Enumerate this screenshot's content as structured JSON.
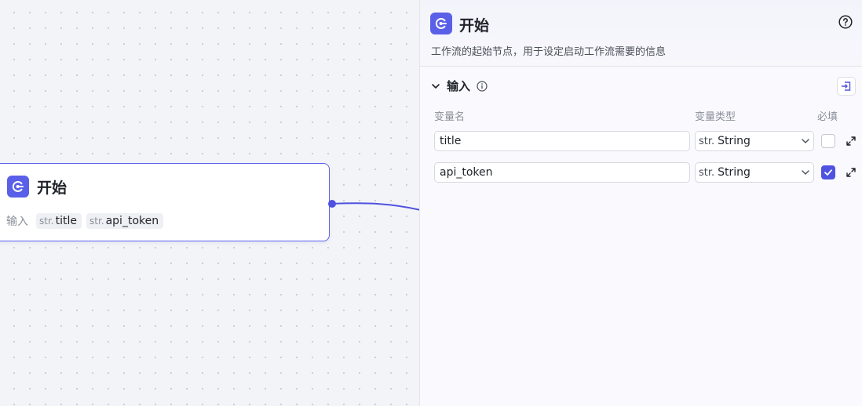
{
  "node": {
    "title": "开始",
    "input_label": "输入",
    "inputs": [
      {
        "type": "str.",
        "name": "title"
      },
      {
        "type": "str.",
        "name": "api_token"
      }
    ]
  },
  "panel": {
    "title": "开始",
    "description": "工作流的起始节点，用于设定启动工作流需要的信息",
    "section_title": "输入",
    "columns": {
      "name": "变量名",
      "type": "变量类型",
      "required": "必填"
    },
    "variables": [
      {
        "name": "title",
        "type_prefix": "str.",
        "type": "String",
        "required": false
      },
      {
        "name": "api_token",
        "type_prefix": "str.",
        "type": "String",
        "required": true
      }
    ]
  },
  "colors": {
    "accent": "#5a5fe8",
    "edge": "#4f52e0"
  },
  "icons": [
    "start-node-icon",
    "help-icon",
    "chevron-down-icon",
    "info-icon",
    "collapse-panel-icon",
    "chevron-down-icon",
    "check-icon",
    "expand-icon"
  ]
}
